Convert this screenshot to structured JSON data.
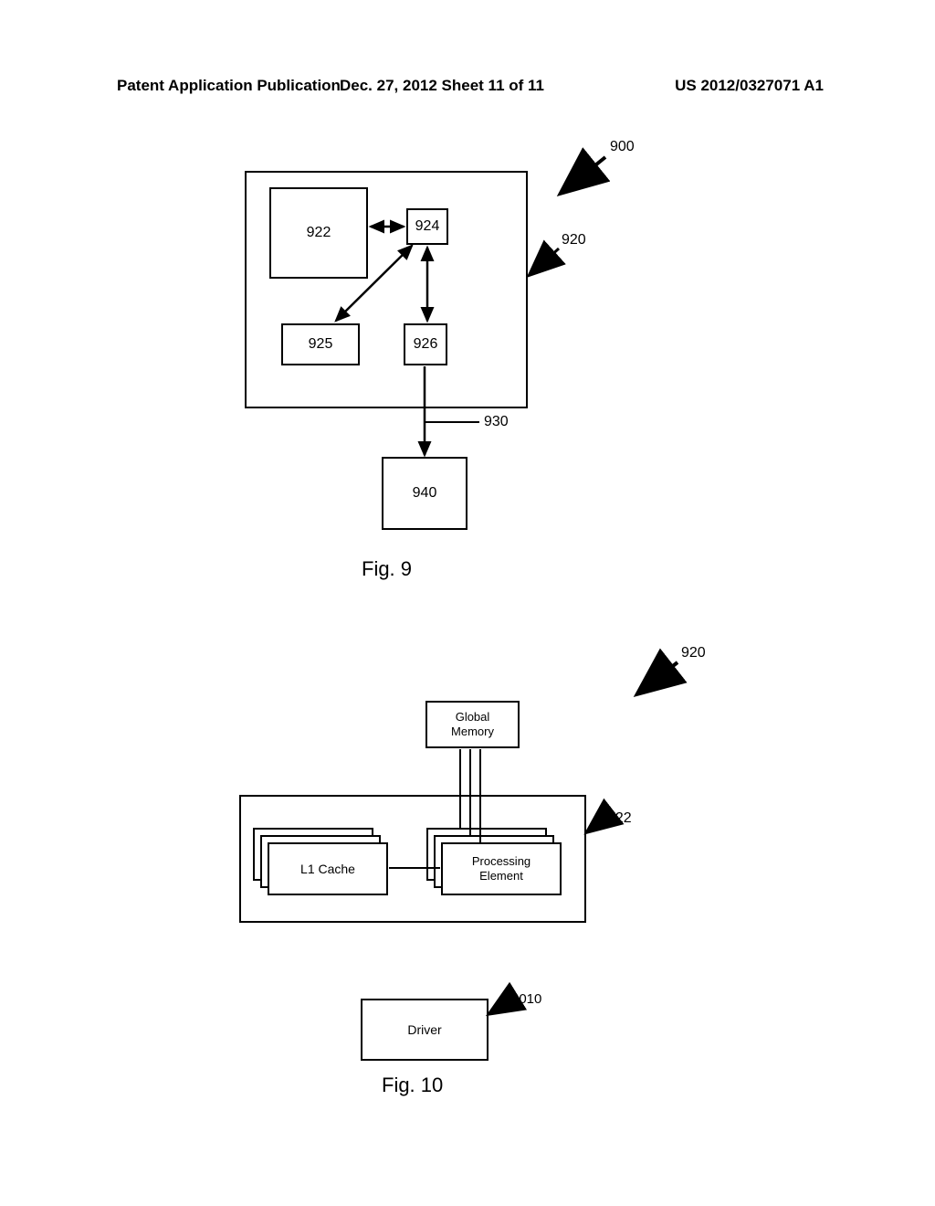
{
  "header": {
    "left": "Patent Application Publication",
    "center": "Dec. 27, 2012  Sheet 11 of 11",
    "right": "US 2012/0327071 A1"
  },
  "fig9": {
    "caption": "Fig. 9",
    "boxes": {
      "b922": "922",
      "b924": "924",
      "b925": "925",
      "b926": "926",
      "b940": "940"
    },
    "labels": {
      "l900": "900",
      "l920": "920",
      "l930": "930"
    }
  },
  "fig10": {
    "caption": "Fig. 10",
    "labels": {
      "l920": "920",
      "l922": "922",
      "l1010": "1010"
    },
    "boxes": {
      "global_memory": "Global\nMemory",
      "l1_cache": "L1 Cache",
      "processing_element": "Processing\nElement",
      "driver": "Driver"
    }
  }
}
